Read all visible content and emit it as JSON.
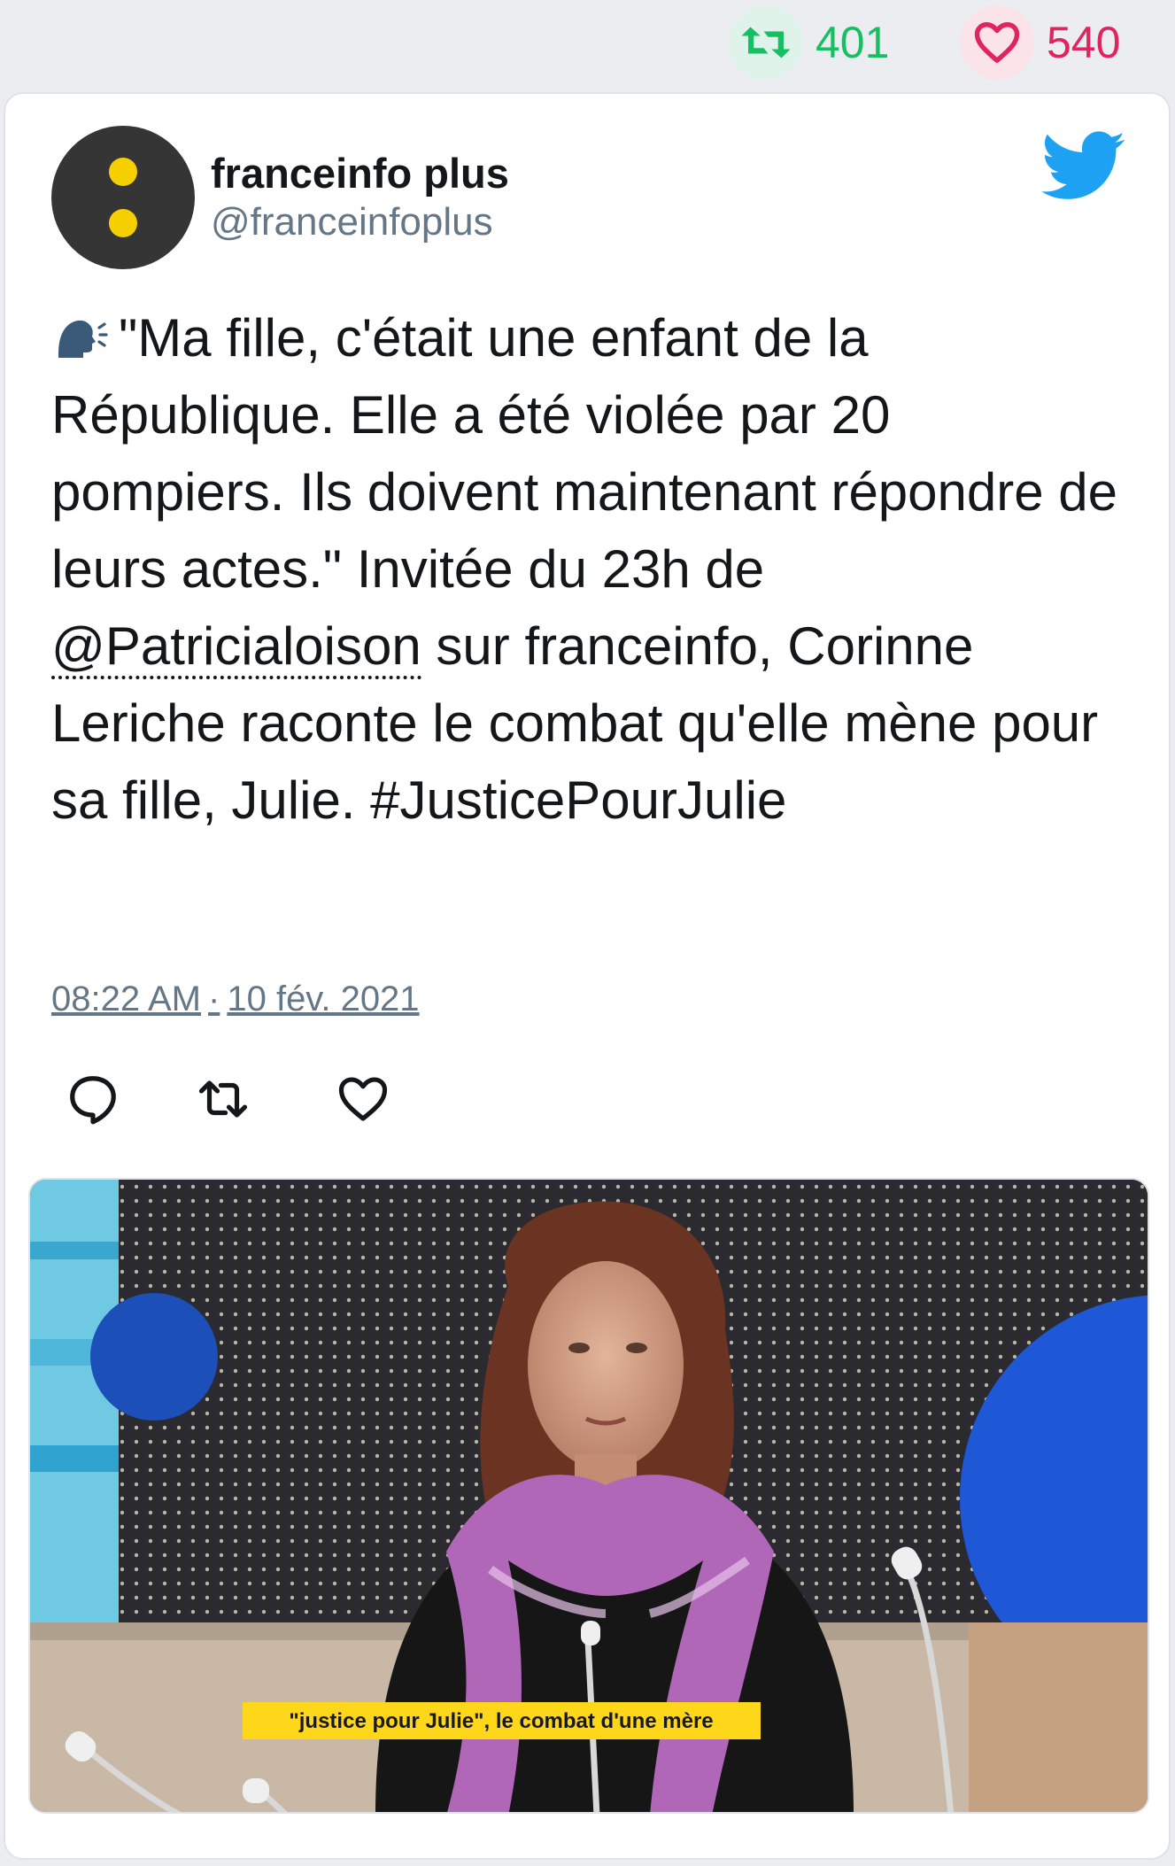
{
  "stats": {
    "retweet_count": "401",
    "like_count": "540"
  },
  "tweet": {
    "display_name": "franceinfo plus",
    "handle": "@franceinfoplus",
    "text_part1": "\"Ma fille, c'était une enfant de la République. Elle a été violée par 20 pompiers. Ils doivent maintenant répondre de leurs actes.\" Invitée du 23h de ",
    "mention": "@Patricialoison",
    "text_part2": " sur franceinfo, Corinne Leriche raconte le combat qu'elle mène pour sa fille, Julie. ",
    "hashtag": "#JusticePourJulie",
    "time": "08:22 AM",
    "date": "10 fév. 2021",
    "separator": "·"
  },
  "media": {
    "caption": "\"justice pour Julie\", le combat d'une mère"
  },
  "icons": {
    "retweet": "retweet-icon",
    "like": "heart-icon",
    "reply": "reply-icon",
    "brand": "twitter-bird-icon",
    "speaking": "speaking-head-icon"
  },
  "colors": {
    "retweet_green": "#17bf63",
    "like_red": "#e0245e",
    "twitter_blue": "#1da1f2",
    "muted": "#657786"
  }
}
